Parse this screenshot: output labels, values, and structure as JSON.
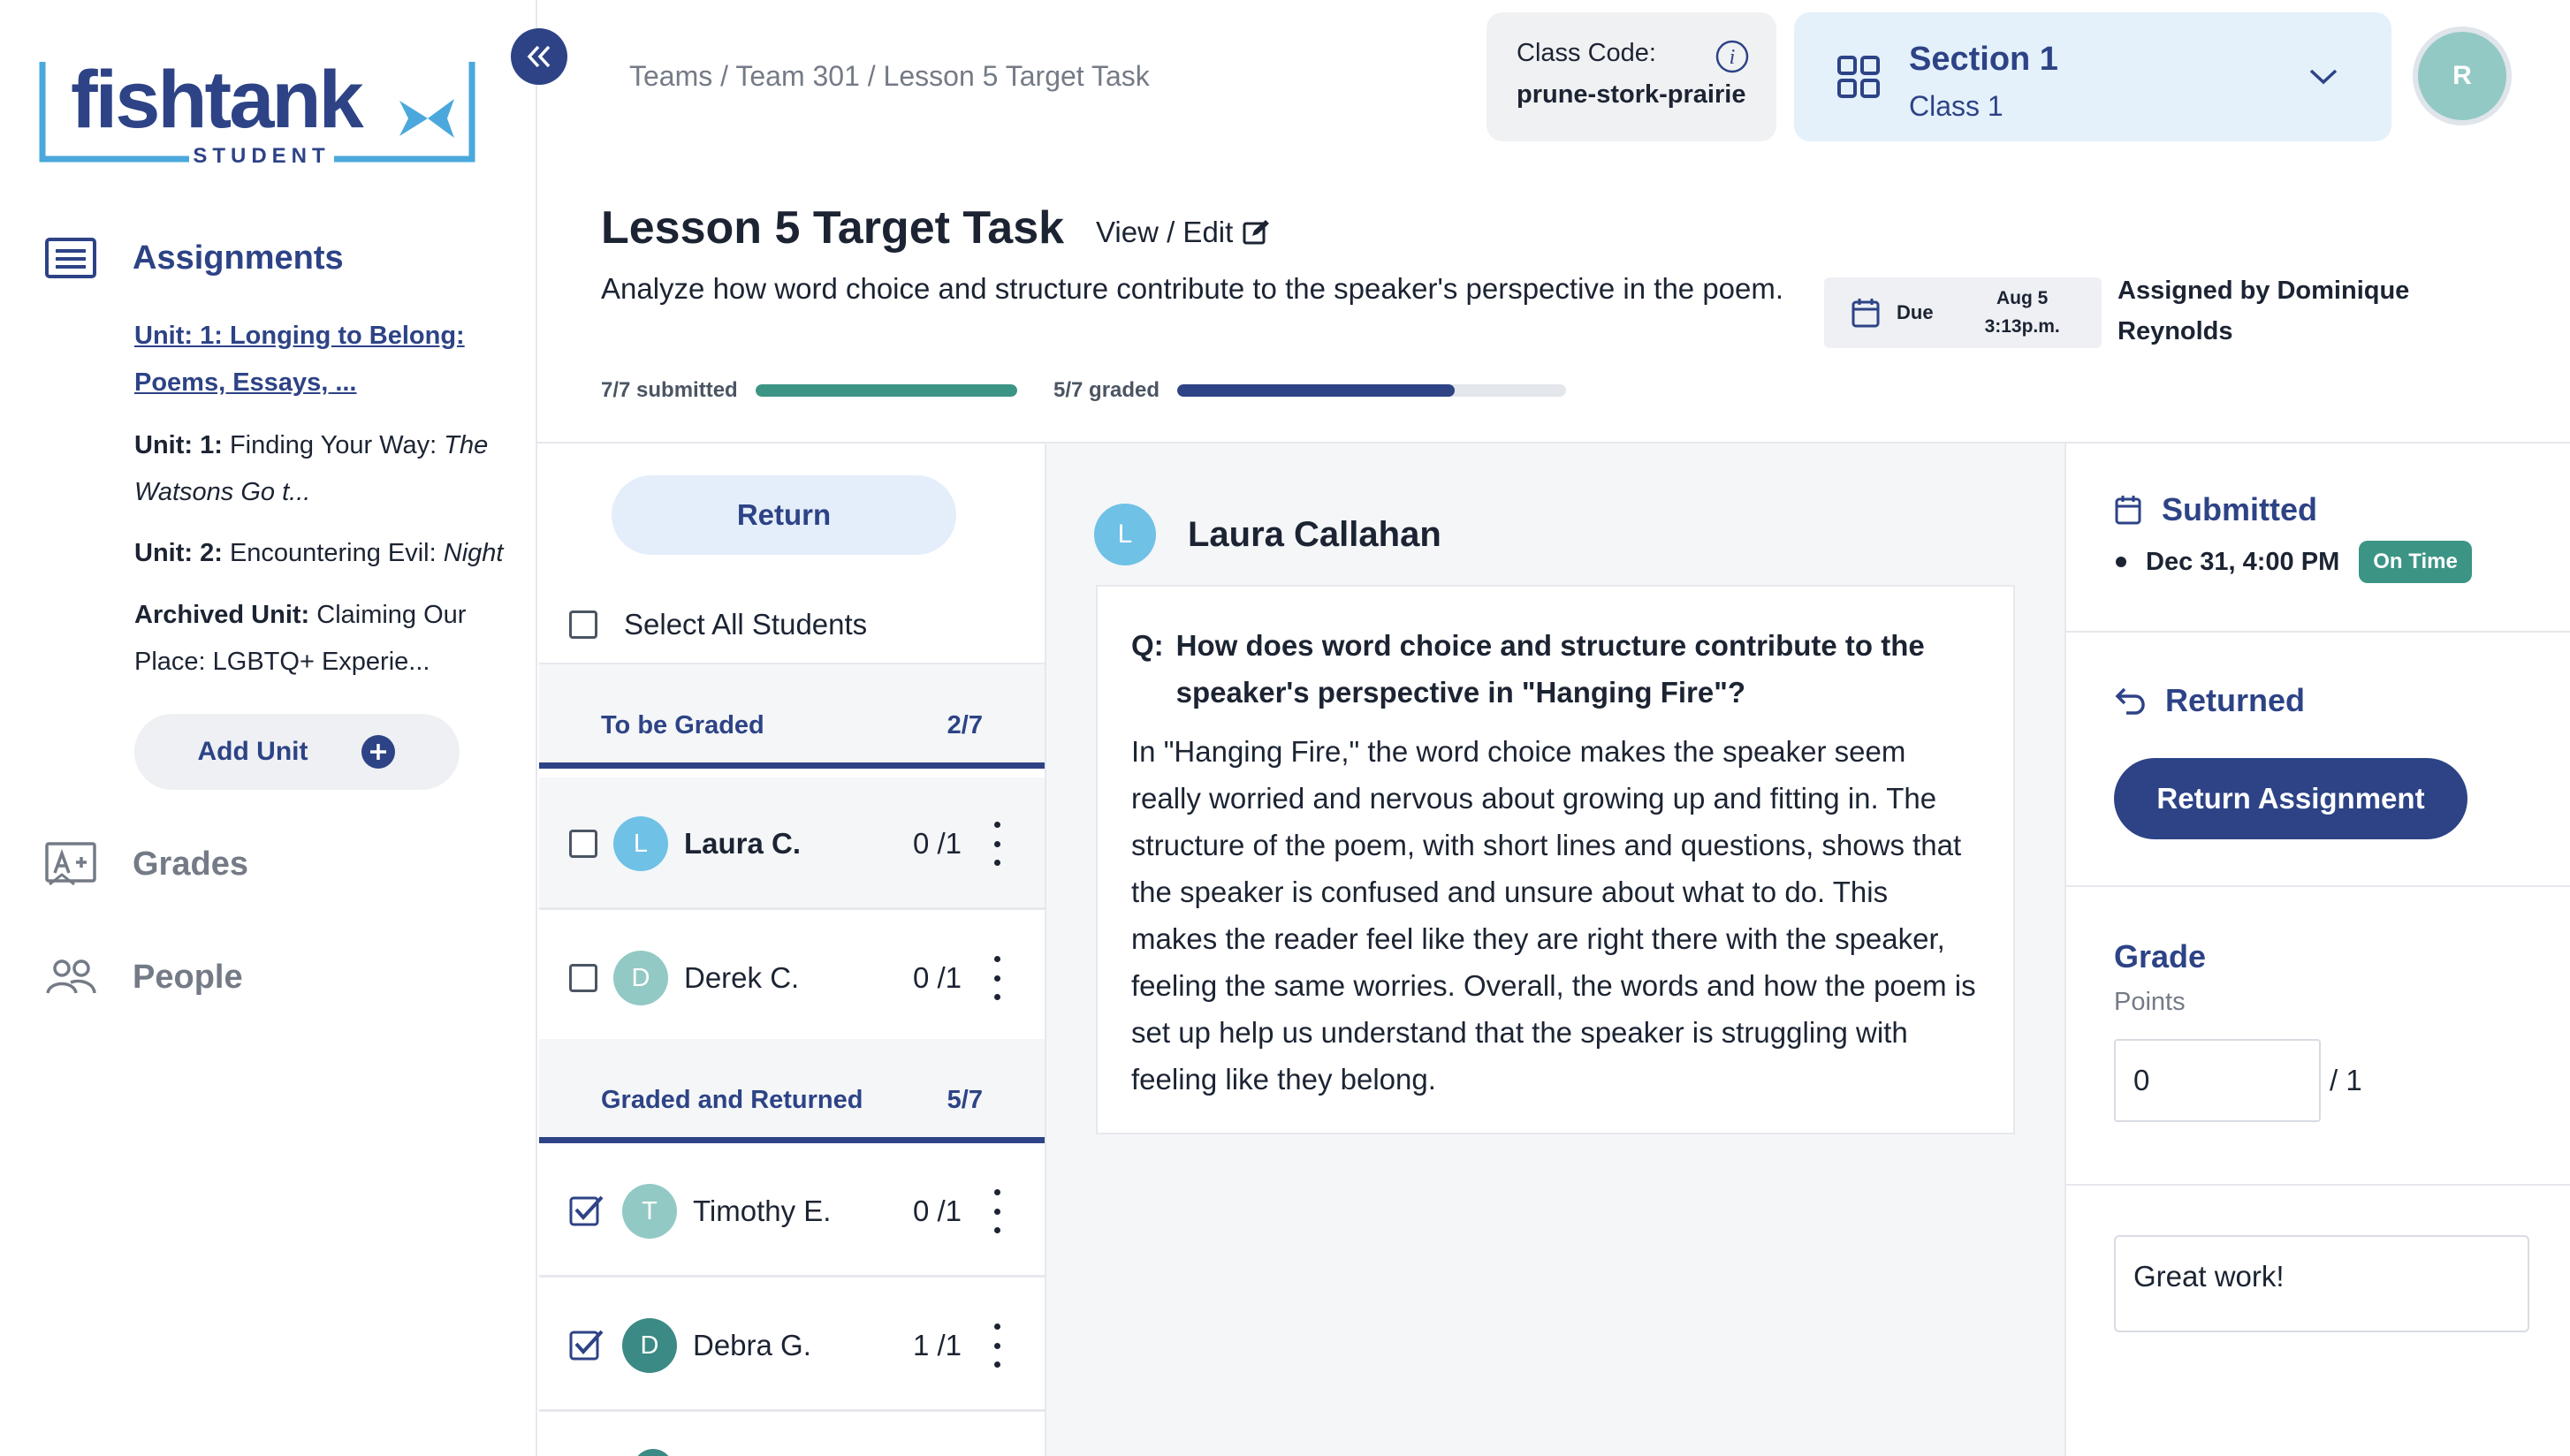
{
  "sidebar": {
    "logo_text": "fishtank",
    "logo_sub": "STUDENT",
    "nav": {
      "assignments": "Assignments",
      "grades": "Grades",
      "people": "People"
    },
    "units": [
      {
        "prefix": "Unit: 1:",
        "title": "Longing to Belong: Poems, Essays, ...",
        "active": true
      },
      {
        "prefix": "Unit: 1:",
        "title": "Finding Your Way:",
        "title_italic": "The Watsons Go t...",
        "active": false
      },
      {
        "prefix": "Unit: 2:",
        "title": "Encountering Evil:",
        "title_italic": "Night",
        "active": false
      },
      {
        "prefix": "Archived Unit:",
        "title": "Claiming Our Place: LGBTQ+ Experie...",
        "active": false
      }
    ],
    "add_unit": "Add Unit"
  },
  "header": {
    "breadcrumb": [
      "Teams",
      "Team 301",
      "Lesson 5 Target Task"
    ],
    "breadcrumb_sep": " / ",
    "class_code_label": "Class Code:",
    "class_code_value": "prune-stork-prairie",
    "section_title": "Section 1",
    "section_sub": "Class 1",
    "avatar_initial": "R"
  },
  "task": {
    "title": "Lesson 5 Target Task",
    "view_edit": "View / Edit",
    "description": "Analyze how word choice and structure contribute to the speaker's perspective in the poem.",
    "submitted_label": "7/7 submitted",
    "submitted_fraction": 1.0,
    "graded_label": "5/7 graded",
    "graded_fraction": 0.714,
    "due_label": "Due",
    "due_date": "Aug 5",
    "due_time": "3:13p.m.",
    "assigned_by": "Assigned by Dominique Reynolds"
  },
  "students": {
    "return_button": "Return",
    "select_all": "Select All Students",
    "groups": [
      {
        "name": "To be Graded",
        "count": "2/7",
        "rows": [
          {
            "initial": "L",
            "name": "Laura C.",
            "score": "0 /1",
            "checked": false,
            "avatar_color": "#6fc1e6",
            "bold": true
          },
          {
            "initial": "D",
            "name": "Derek C.",
            "score": "0 /1",
            "checked": false,
            "avatar_color": "#93c9c4",
            "bold": false
          }
        ]
      },
      {
        "name": "Graded and Returned",
        "count": "5/7",
        "rows": [
          {
            "initial": "T",
            "name": "Timothy E.",
            "score": "0 /1",
            "checked": true,
            "avatar_color": "#93c9c4",
            "bold": false
          },
          {
            "initial": "D",
            "name": "Debra G.",
            "score": "1 /1",
            "checked": true,
            "avatar_color": "#3c8a85",
            "bold": false
          }
        ]
      }
    ]
  },
  "response": {
    "student_initial": "L",
    "student_name": "Laura Callahan",
    "q_prefix": "Q:",
    "question": "How does word choice and structure contribute to the speaker's perspective in \"Hanging Fire\"?",
    "answer": "In \"Hanging Fire,\" the word choice makes the speaker seem really worried and nervous about growing up and fitting in. The structure of the poem, with short lines and questions, shows that the speaker is confused and unsure about what to do. This makes the reader feel like they are right there with the speaker, feeling the same worries. Overall, the words and how the poem is set up help us understand that the speaker is struggling with feeling like they belong."
  },
  "status": {
    "submitted_title": "Submitted",
    "submitted_date": "Dec 31, 4:00 PM",
    "on_time_badge": "On Time",
    "returned_title": "Returned",
    "return_assignment": "Return Assignment",
    "grade_title": "Grade",
    "points_label": "Points",
    "grade_value": "0",
    "grade_out_of": "/ 1",
    "feedback": "Great work!"
  },
  "colors": {
    "brand": "#2d4386",
    "logo_blue": "#4aa8dc",
    "submitted_bar": "#3c9485",
    "graded_bar": "#2d4386"
  }
}
